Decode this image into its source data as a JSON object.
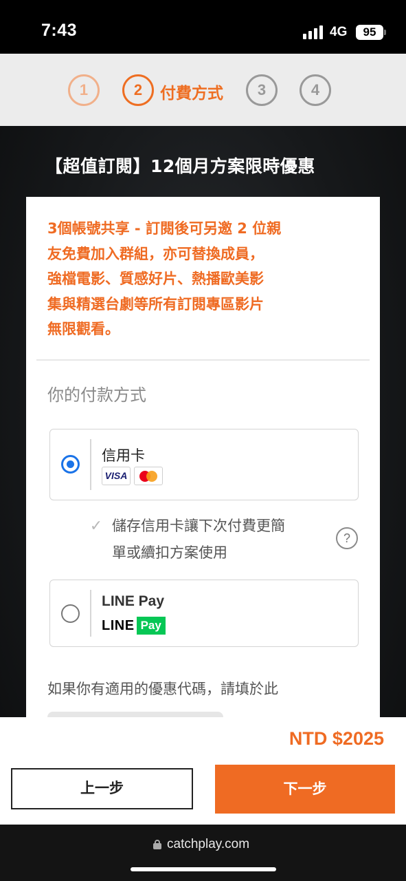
{
  "status_bar": {
    "time": "7:43",
    "network": "4G",
    "battery": "95"
  },
  "stepper": {
    "steps": [
      {
        "number": "1",
        "state": "completed"
      },
      {
        "number": "2",
        "state": "active",
        "label": "付費方式"
      },
      {
        "number": "3",
        "state": "upcoming"
      },
      {
        "number": "4",
        "state": "upcoming"
      }
    ]
  },
  "plan": {
    "title": "【超值訂閱】12個月方案限時優惠",
    "promo_lines": [
      "3個帳號共享 - 訂閱後可另邀 2 位親",
      "友免費加入群組，亦可替換成員，",
      "強檔電影、質感好片、熱播歐美影",
      "集與精選台劇等所有訂閱專區影片",
      "無限觀看。"
    ]
  },
  "payment": {
    "heading": "你的付款方式",
    "credit_card": {
      "label": "信用卡",
      "selected": true,
      "visa_text": "VISA"
    },
    "save_card": {
      "checked": true,
      "text_lines": [
        "儲存信用卡讓下次付費更簡",
        "單或續扣方案使用"
      ],
      "help_symbol": "?"
    },
    "line_pay": {
      "label": "LINE Pay",
      "selected": false,
      "logo_line": "LINE",
      "logo_pay": "Pay"
    },
    "coupon_prompt": "如果你有適用的優惠代碼，請填於此"
  },
  "footer": {
    "price": "NTD $2025",
    "prev_label": "上一步",
    "next_label": "下一步"
  },
  "browser": {
    "url": "catchplay.com"
  },
  "colors": {
    "accent": "#ef6b23",
    "radio_selected": "#1a73e8",
    "line_green": "#06c755"
  }
}
